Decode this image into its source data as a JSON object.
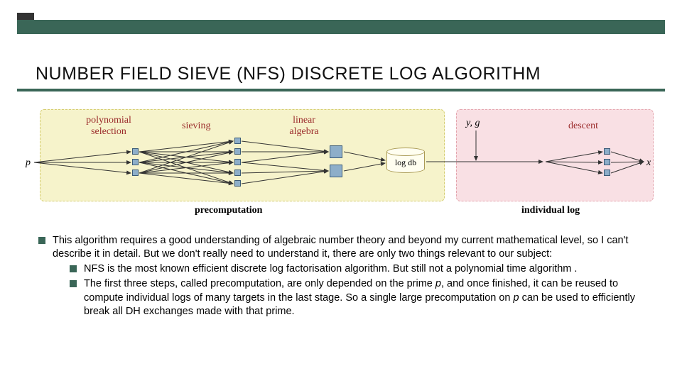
{
  "title": "NUMBER FIELD SIEVE (NFS) DISCRETE LOG ALGORITHM",
  "diagram": {
    "stage1": "polynomial\nselection",
    "stage2": "sieving",
    "stage3": "linear\nalgebra",
    "stage4": "descent",
    "region1": "precomputation",
    "region2": "individual log",
    "p": "p",
    "x": "x",
    "yg": "y, g",
    "db": "log db"
  },
  "bullets": {
    "main": "This algorithm requires a good understanding of algebraic number theory and beyond my current mathematical level, so I can't describe it in detail. But we don't really need to understand it, there are only two things relevant to our subject:",
    "sub1": "NFS is the most known efficient discrete log factorisation algorithm. But still not a polynomial time algorithm .",
    "sub2_a": "The first three steps, called precomputation, are only depended on the prime ",
    "sub2_b": ", and once finished, it can be reused to compute individual logs of many targets in the last stage. So a single large precomputation on ",
    "sub2_c": " can be used to efficiently break all DH exchanges made with that prime.",
    "p": "p"
  }
}
